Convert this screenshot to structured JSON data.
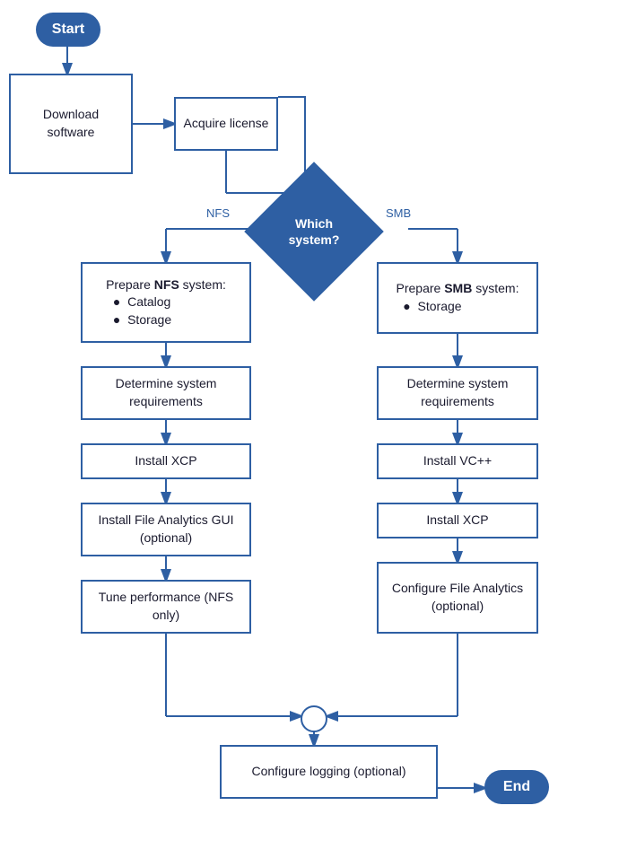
{
  "nodes": {
    "start": {
      "label": "Start"
    },
    "download": {
      "label": "Download software"
    },
    "acquire": {
      "label": "Acquire license"
    },
    "which": {
      "label": "Which system?"
    },
    "nfs_label": {
      "label": "NFS"
    },
    "smb_label": {
      "label": "SMB"
    },
    "prepare_nfs": {
      "label": "Prepare <b>NFS</b> system:\n• Catalog\n• Storage"
    },
    "prepare_smb": {
      "label": "Prepare <b>SMB</b> system:\n• Storage"
    },
    "req_nfs": {
      "label": "Determine system requirements"
    },
    "req_smb": {
      "label": "Determine system requirements"
    },
    "install_xcp_nfs": {
      "label": "Install XCP"
    },
    "install_vc": {
      "label": "Install VC++"
    },
    "install_fa_gui": {
      "label": "Install File Analytics GUI (optional)"
    },
    "install_xcp_smb": {
      "label": "Install XCP"
    },
    "tune": {
      "label": "Tune performance (NFS only)"
    },
    "config_fa": {
      "label": "Configure File Analytics (optional)"
    },
    "config_logging": {
      "label": "Configure logging (optional)"
    },
    "end": {
      "label": "End"
    }
  }
}
